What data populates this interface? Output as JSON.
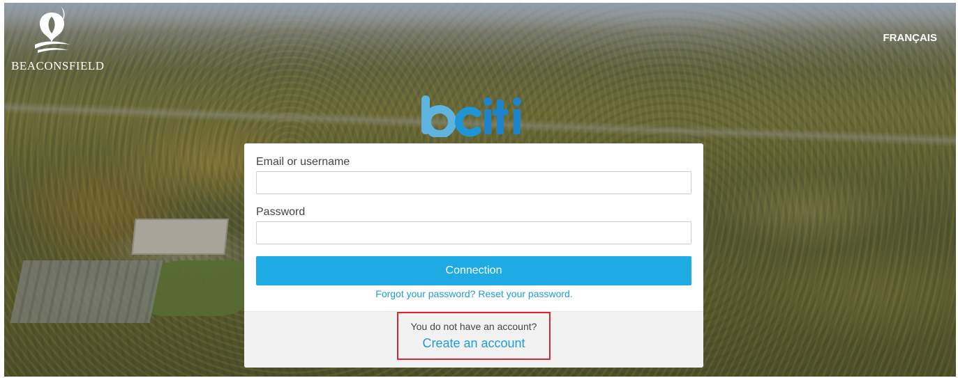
{
  "header": {
    "logo_text": "BEACONSFIELD",
    "language_link": "FRANÇAIS"
  },
  "brand": {
    "name": "bciti",
    "colors": {
      "b": "#5fb3df",
      "c": "#1e96d6",
      "iti": "#1d84cc"
    }
  },
  "login": {
    "email_label": "Email or username",
    "email_value": "",
    "password_label": "Password",
    "password_value": "",
    "submit_label": "Connection",
    "forgot_link": "Forgot your password? Reset your password.",
    "no_account_text": "You do not have an account?",
    "create_account_link": "Create an account"
  },
  "colors": {
    "accent": "#1eabe3",
    "link": "#1e9bd8",
    "highlight_border": "#d9252e"
  }
}
